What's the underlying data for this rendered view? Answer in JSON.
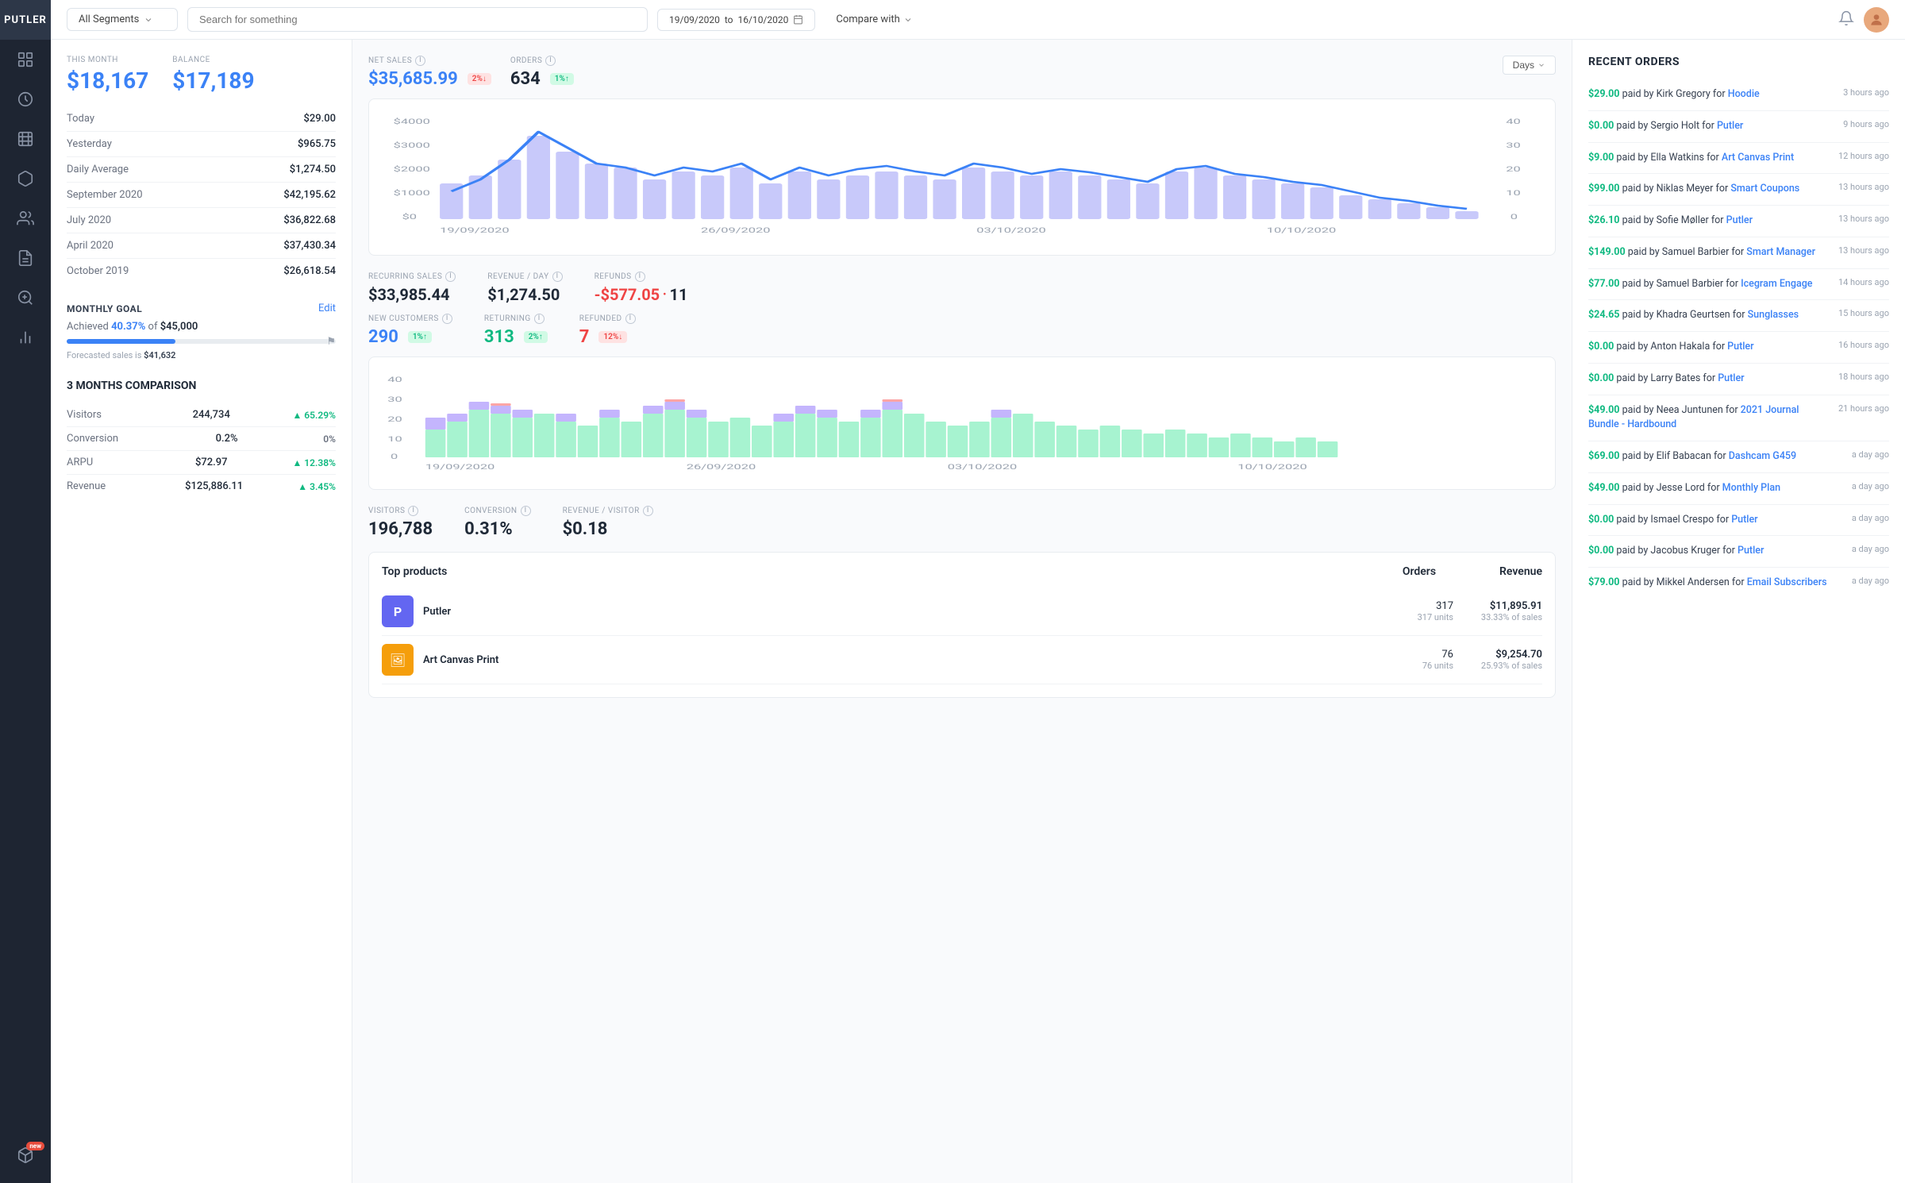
{
  "sidebar": {
    "logo": "PUTLER",
    "icons": [
      {
        "name": "dashboard-icon",
        "symbol": "⊞"
      },
      {
        "name": "sales-icon",
        "symbol": "💲"
      },
      {
        "name": "orders-icon",
        "symbol": "🛒"
      },
      {
        "name": "products-icon",
        "symbol": "📦"
      },
      {
        "name": "customers-icon",
        "symbol": "👥"
      },
      {
        "name": "reports-icon",
        "symbol": "📊"
      },
      {
        "name": "goals-icon",
        "symbol": "🎯"
      },
      {
        "name": "marketing-icon",
        "symbol": "📢"
      },
      {
        "name": "apps-icon",
        "symbol": "🧩",
        "badge": "new"
      }
    ]
  },
  "topbar": {
    "segment": "All Segments",
    "search_placeholder": "Search for something",
    "date_from": "19/09/2020",
    "date_to": "16/10/2020",
    "compare_label": "Compare with"
  },
  "stats": {
    "this_month_label": "THIS MONTH",
    "balance_label": "BALANCE",
    "this_month_value": "$18,167",
    "balance_value": "$17,189",
    "rows": [
      {
        "label": "Today",
        "value": "$29.00"
      },
      {
        "label": "Yesterday",
        "value": "$965.75"
      },
      {
        "label": "Daily Average",
        "value": "$1,274.50"
      },
      {
        "label": "September 2020",
        "value": "$42,195.62"
      },
      {
        "label": "July 2020",
        "value": "$36,822.68"
      },
      {
        "label": "April 2020",
        "value": "$37,430.34"
      },
      {
        "label": "October 2019",
        "value": "$26,618.54"
      }
    ]
  },
  "monthly_goal": {
    "title": "MONTHLY GOAL",
    "achieved_pct": "40.37%",
    "target": "$45,000",
    "edit_label": "Edit",
    "forecast_label": "Forecasted sales is",
    "forecast_value": "$41,632"
  },
  "comparison": {
    "title": "3 MONTHS COMPARISON",
    "rows": [
      {
        "label": "Visitors",
        "value": "244,734",
        "change": "▲ 65.29%",
        "direction": "up"
      },
      {
        "label": "Conversion",
        "value": "0.2%",
        "change": "0%",
        "direction": "neutral"
      },
      {
        "label": "ARPU",
        "value": "$72.97",
        "change": "▲ 12.38%",
        "direction": "up"
      },
      {
        "label": "Revenue",
        "value": "$125,886.11",
        "change": "▲ 3.45%",
        "direction": "up"
      }
    ]
  },
  "net_sales": {
    "label": "NET SALES",
    "value": "$35,685.99",
    "badge_text": "2%↓",
    "badge_type": "red"
  },
  "orders": {
    "label": "ORDERS",
    "value": "634",
    "badge_text": "1%↑",
    "badge_type": "green"
  },
  "days_button": "Days",
  "chart_dates": [
    "19/09/2020",
    "26/09/2020",
    "03/10/2020",
    "10/10/2020"
  ],
  "recurring_sales": {
    "label": "RECURRING SALES",
    "value": "$33,985.44"
  },
  "revenue_day": {
    "label": "REVENUE / DAY",
    "value": "$1,274.50"
  },
  "refunds": {
    "label": "REFUNDS",
    "value": "-$577.05",
    "count": "11"
  },
  "new_customers": {
    "label": "NEW CUSTOMERS",
    "value": "290",
    "badge_text": "1%↑",
    "badge_type": "green"
  },
  "returning": {
    "label": "RETURNING",
    "value": "313",
    "badge_text": "2%↑",
    "badge_type": "green"
  },
  "refunded": {
    "label": "REFUNDED",
    "value": "7",
    "badge_text": "12%↓",
    "badge_type": "red"
  },
  "visitors": {
    "label": "VISITORS",
    "value": "196,788"
  },
  "conversion": {
    "label": "CONVERSION",
    "value": "0.31%"
  },
  "revenue_visitor": {
    "label": "REVENUE / VISITOR",
    "value": "$0.18"
  },
  "top_products": {
    "title": "Top products",
    "col_orders": "Orders",
    "col_revenue": "Revenue",
    "items": [
      {
        "name": "Putler",
        "orders": "317",
        "units": "317 units",
        "revenue": "$11,895.91",
        "pct": "33.33% of sales",
        "color": "#6366f1"
      },
      {
        "name": "Art Canvas Print",
        "orders": "76",
        "units": "76 units",
        "revenue": "$9,254.70",
        "pct": "25.93% of sales",
        "color": "#f59e0b"
      }
    ]
  },
  "recent_orders": {
    "title": "RECENT ORDERS",
    "items": [
      {
        "amount": "$29.00",
        "customer": "Kirk Gregory",
        "product": "Hoodie",
        "time": "3 hours ago"
      },
      {
        "amount": "$0.00",
        "customer": "Sergio Holt",
        "product": "Putler",
        "time": "9 hours ago"
      },
      {
        "amount": "$9.00",
        "customer": "Ella Watkins",
        "product": "Art Canvas Print",
        "time": "12 hours ago"
      },
      {
        "amount": "$99.00",
        "customer": "Niklas Meyer",
        "product": "Smart Coupons",
        "time": "13 hours ago"
      },
      {
        "amount": "$26.10",
        "customer": "Sofie Møller",
        "product": "Putler",
        "time": "13 hours ago"
      },
      {
        "amount": "$149.00",
        "customer": "Samuel Barbier",
        "product": "Smart Manager",
        "time": "13 hours ago"
      },
      {
        "amount": "$77.00",
        "customer": "Samuel Barbier",
        "product": "Icegram Engage",
        "time": "14 hours ago"
      },
      {
        "amount": "$24.65",
        "customer": "Khadra Geurtsen",
        "product": "Sunglasses",
        "time": "15 hours ago"
      },
      {
        "amount": "$0.00",
        "customer": "Anton Hakala",
        "product": "Putler",
        "time": "16 hours ago"
      },
      {
        "amount": "$0.00",
        "customer": "Larry Bates",
        "product": "Putler",
        "time": "18 hours ago"
      },
      {
        "amount": "$49.00",
        "customer": "Neea Juntunen",
        "product": "2021 Journal Bundle - Hardbound",
        "time": "21 hours ago"
      },
      {
        "amount": "$69.00",
        "customer": "Elif Babacan",
        "product": "Dashcam G459",
        "time": "a day ago"
      },
      {
        "amount": "$49.00",
        "customer": "Jesse Lord",
        "product": "Monthly Plan",
        "time": "a day ago"
      },
      {
        "amount": "$0.00",
        "customer": "Ismael Crespo",
        "product": "Putler",
        "time": "a day ago"
      },
      {
        "amount": "$0.00",
        "customer": "Jacobus Kruger",
        "product": "Putler",
        "time": "a day ago"
      },
      {
        "amount": "$79.00",
        "customer": "Mikkel Andersen",
        "product": "Email Subscribers",
        "time": "a day ago"
      }
    ]
  }
}
